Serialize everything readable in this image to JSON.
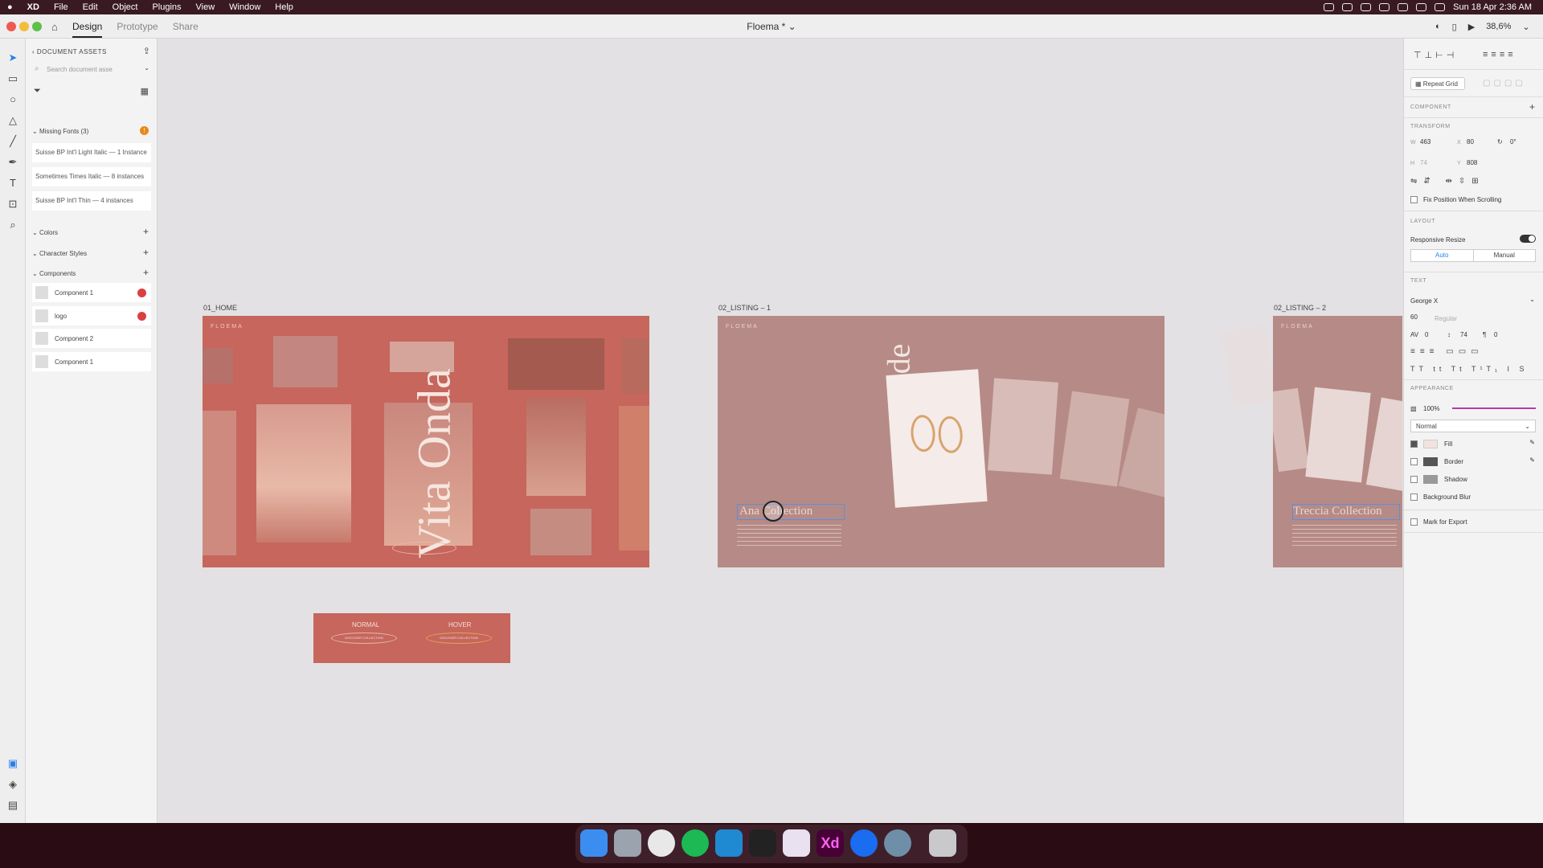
{
  "menubar": {
    "apple": "",
    "items": [
      "XD",
      "File",
      "Edit",
      "Object",
      "Plugins",
      "View",
      "Window",
      "Help"
    ],
    "clock": "Sun 18 Apr  2:36 AM"
  },
  "window": {
    "tabs": [
      "Design",
      "Prototype",
      "Share"
    ],
    "doc_title": "Floema * ⌄",
    "zoom": "38,6%"
  },
  "assets": {
    "header": "DOCUMENT ASSETS",
    "search_placeholder": "Search document asse",
    "missing_fonts_title": "Missing Fonts (3)",
    "missing_fonts": [
      "Suisse BP Int'l Light Italic — 1 Instance",
      "Sometimes Times Italic — 8 instances",
      "Suisse BP Int'l Thin — 4 instances"
    ],
    "colors": "Colors",
    "character_styles": "Character Styles",
    "components_title": "Components",
    "components": [
      "Component 1",
      "logo",
      "Component 2",
      "Component 1"
    ]
  },
  "canvas": {
    "artboards": [
      "01_HOME",
      "02_LISTING – 1",
      "02_LISTING – 2"
    ],
    "home_brand": "FLOEMA",
    "home_title": "Vita Onda",
    "listing1_brand": "FLOEMA",
    "listing1_title": "Ana Collection",
    "listing2_brand": "FLOEMA",
    "listing2_title": "Treccia Collection",
    "state_labels": [
      "NORMAL",
      "HOVER"
    ],
    "state_button_text": [
      "DISCOVER COLLECTION",
      "DISCOVER COLLECTION"
    ]
  },
  "props": {
    "repeat_grid": "Repeat Grid",
    "component": "COMPONENT",
    "transform": "TRANSFORM",
    "w_label": "W",
    "w": "463",
    "x_label": "X",
    "x": "80",
    "rot": "0°",
    "h_label": "H",
    "h": "74",
    "y_label": "Y",
    "y": "808",
    "fix_position": "Fix Position When Scrolling",
    "layout": "LAYOUT",
    "responsive_resize": "Responsive Resize",
    "auto": "Auto",
    "manual": "Manual",
    "text": "TEXT",
    "font": "George X",
    "font_size": "60",
    "font_weight": "Regular",
    "char_spacing": "0",
    "line_spacing": "74",
    "para_spacing": "0",
    "appearance": "APPEARANCE",
    "opacity": "100%",
    "blend": "Normal",
    "fill": "Fill",
    "border": "Border",
    "shadow": "Shadow",
    "background_blur": "Background Blur",
    "mark_for_export": "Mark for Export"
  },
  "colors": {
    "home_bg": "#c6665c",
    "listing_bg": "#b68a86",
    "accent": "#b23ca8"
  }
}
